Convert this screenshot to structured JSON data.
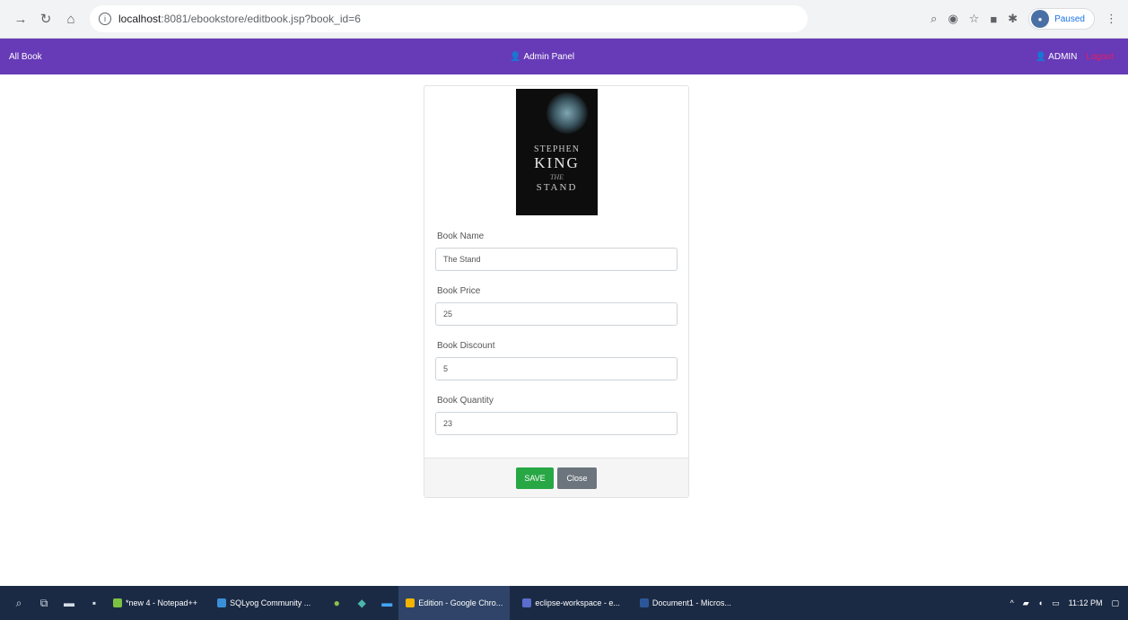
{
  "browser": {
    "url_host": "localhost",
    "url_path": ":8081/ebookstore/editbook.jsp?book_id=6",
    "profile_label": "Paused"
  },
  "navbar": {
    "left_link": "All Book",
    "center_title": "Admin Panel",
    "user_label": "ADMIN",
    "logout_label": "Logout"
  },
  "book": {
    "cover": {
      "author_line1": "STEPHEN",
      "author_line2": "KING",
      "the": "THE",
      "title": "STAND"
    },
    "fields": [
      {
        "label": "Book Name",
        "value": "The Stand"
      },
      {
        "label": "Book Price",
        "value": "25"
      },
      {
        "label": "Book Discount",
        "value": "5"
      },
      {
        "label": "Book Quantity",
        "value": "23"
      }
    ]
  },
  "actions": {
    "save_label": "SAVE",
    "close_label": "Close"
  },
  "taskbar": {
    "tasks": [
      "*new 4 - Notepad++",
      "SQLyog Community ...",
      "Edition - Google Chro...",
      "eclipse-workspace - e...",
      "Document1 - Micros..."
    ],
    "clock": "11:12 PM"
  },
  "colors": {
    "navbar": "#673ab7",
    "save": "#28a745",
    "close": "#6c757d",
    "logout": "#e91e63"
  }
}
